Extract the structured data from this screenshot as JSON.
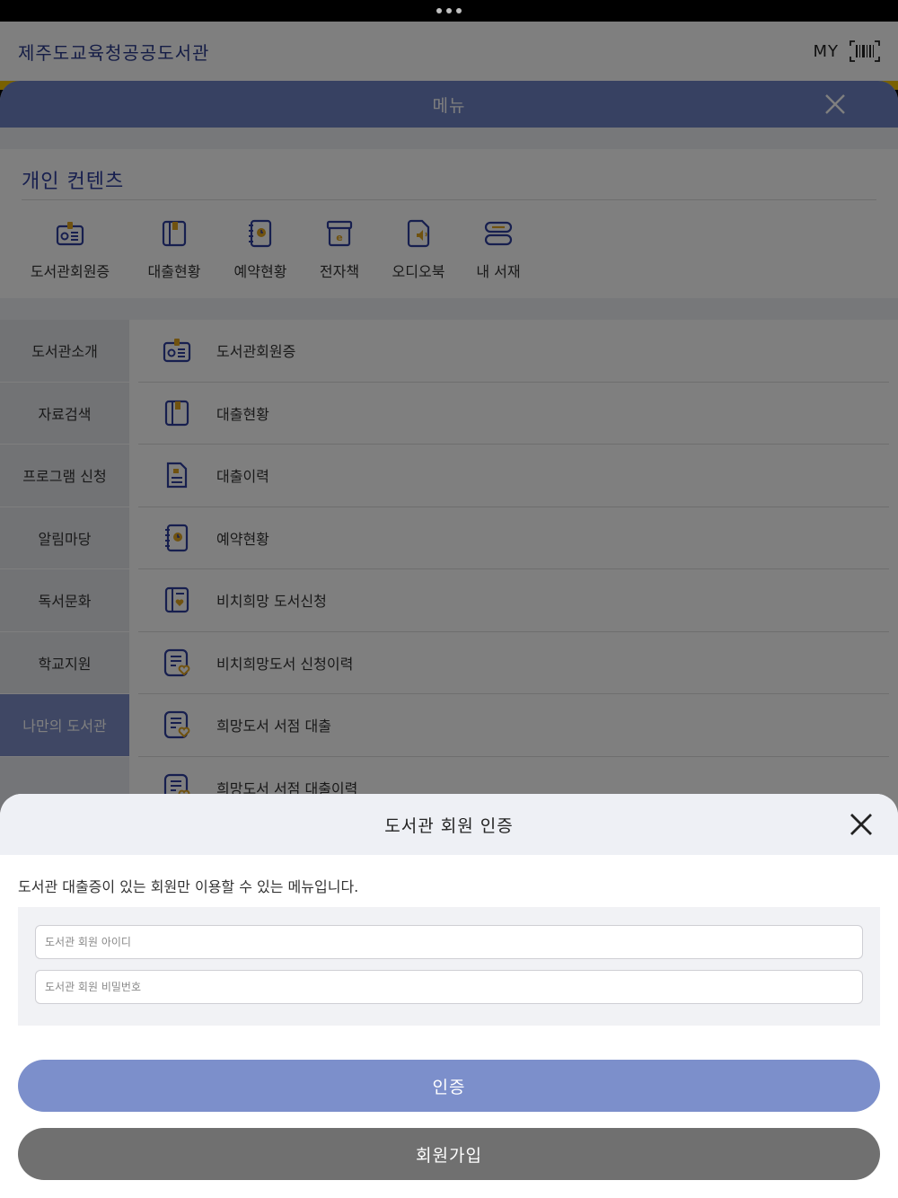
{
  "appbar": {
    "title": "제주도교육청공공도서관",
    "my_label": "MY",
    "barcode_icon": "barcode-icon"
  },
  "menu": {
    "title": "메뉴",
    "close_icon": "close-icon",
    "personal": {
      "title": "개인 컨텐츠",
      "items": [
        {
          "label": "도서관회원증",
          "icon": "member-card-icon"
        },
        {
          "label": "대출현황",
          "icon": "book-loan-icon"
        },
        {
          "label": "예약현황",
          "icon": "reservation-icon"
        },
        {
          "label": "전자책",
          "icon": "ebook-icon"
        },
        {
          "label": "오디오북",
          "icon": "audiobook-icon"
        },
        {
          "label": "내 서재",
          "icon": "bookshelf-icon"
        }
      ]
    },
    "categories": [
      {
        "label": "도서관소개"
      },
      {
        "label": "자료검색"
      },
      {
        "label": "프로그램 신청"
      },
      {
        "label": "알림마당"
      },
      {
        "label": "독서문화"
      },
      {
        "label": "학교지원"
      },
      {
        "label": "나만의 도서관",
        "active": true
      }
    ],
    "submenu": [
      {
        "label": "도서관회원증",
        "icon": "member-card-icon"
      },
      {
        "label": "대출현황",
        "icon": "book-loan-icon"
      },
      {
        "label": "대출이력",
        "icon": "loan-history-icon"
      },
      {
        "label": "예약현황",
        "icon": "reservation-icon"
      },
      {
        "label": "비치희망 도서신청",
        "icon": "wish-book-icon"
      },
      {
        "label": "비치희망도서 신청이력",
        "icon": "wish-history-icon"
      },
      {
        "label": "희망도서 서점 대출",
        "icon": "store-loan-icon"
      },
      {
        "label": "희망도서 서점 대출이력",
        "icon": "store-history-icon"
      }
    ]
  },
  "auth": {
    "title": "도서관 회원 인증",
    "message": "도서관 대출증이 있는 회원만 이용할 수 있는 메뉴입니다.",
    "id_placeholder": "도서관 회원 아이디",
    "id_value": "",
    "pw_placeholder": "도서관 회원 비밀번호",
    "pw_value": "",
    "submit_label": "인증",
    "join_label": "회원가입"
  },
  "colors": {
    "primary": "#7c8fcb",
    "header": "#6f83c4",
    "accent": "#f2c200",
    "navy": "#2f3f9e",
    "icon_accent": "#e0a520"
  }
}
